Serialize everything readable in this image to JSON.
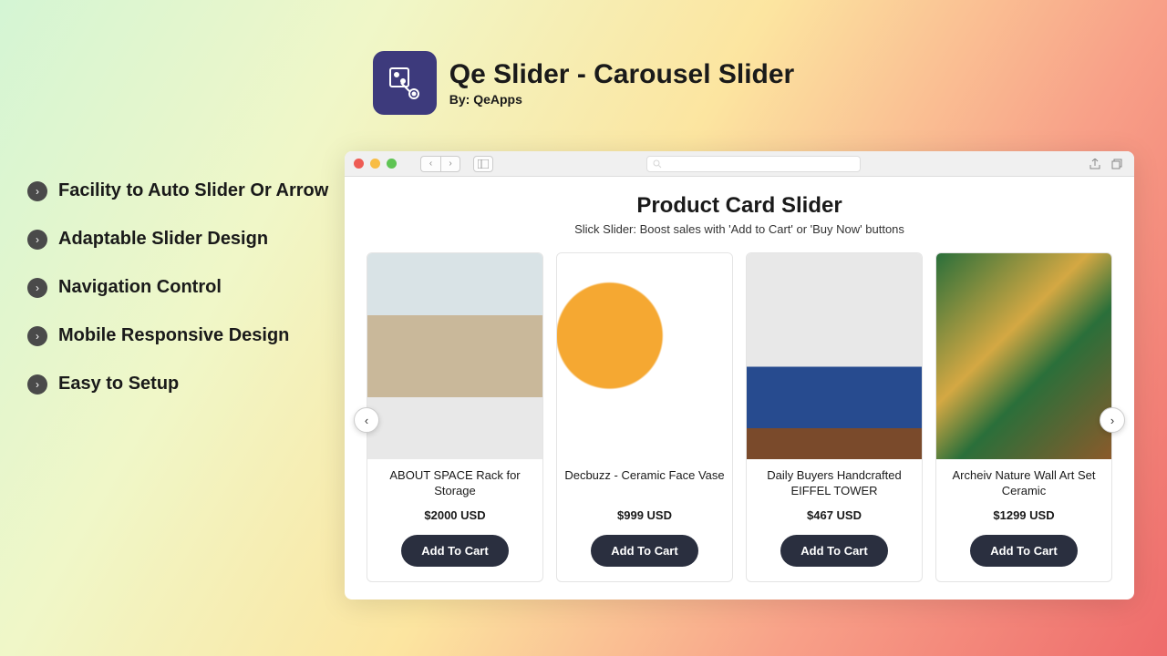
{
  "app": {
    "title": "Qe Slider - Carousel Slider",
    "subtitle": "By: QeApps"
  },
  "features": [
    "Facility to Auto Slider Or Arrow",
    "Adaptable Slider Design",
    "Navigation Control",
    "Mobile Responsive Design",
    "Easy to Setup"
  ],
  "browser": {
    "slider_title": "Product Card Slider",
    "slider_subtitle": "Slick Slider: Boost sales with 'Add to Cart' or 'Buy Now' buttons",
    "add_to_cart_label": "Add To Cart",
    "products": [
      {
        "title": "ABOUT SPACE Rack for Storage",
        "price": "$2000 USD"
      },
      {
        "title": "Decbuzz - Ceramic Face Vase",
        "price": "$999 USD"
      },
      {
        "title": "Daily Buyers Handcrafted EIFFEL TOWER",
        "price": "$467 USD"
      },
      {
        "title": "Archeiv Nature Wall Art Set Ceramic",
        "price": "$1299 USD"
      }
    ]
  },
  "colors": {
    "app_icon_bg": "#3d3a7c",
    "button_bg": "#2a2f3f"
  }
}
